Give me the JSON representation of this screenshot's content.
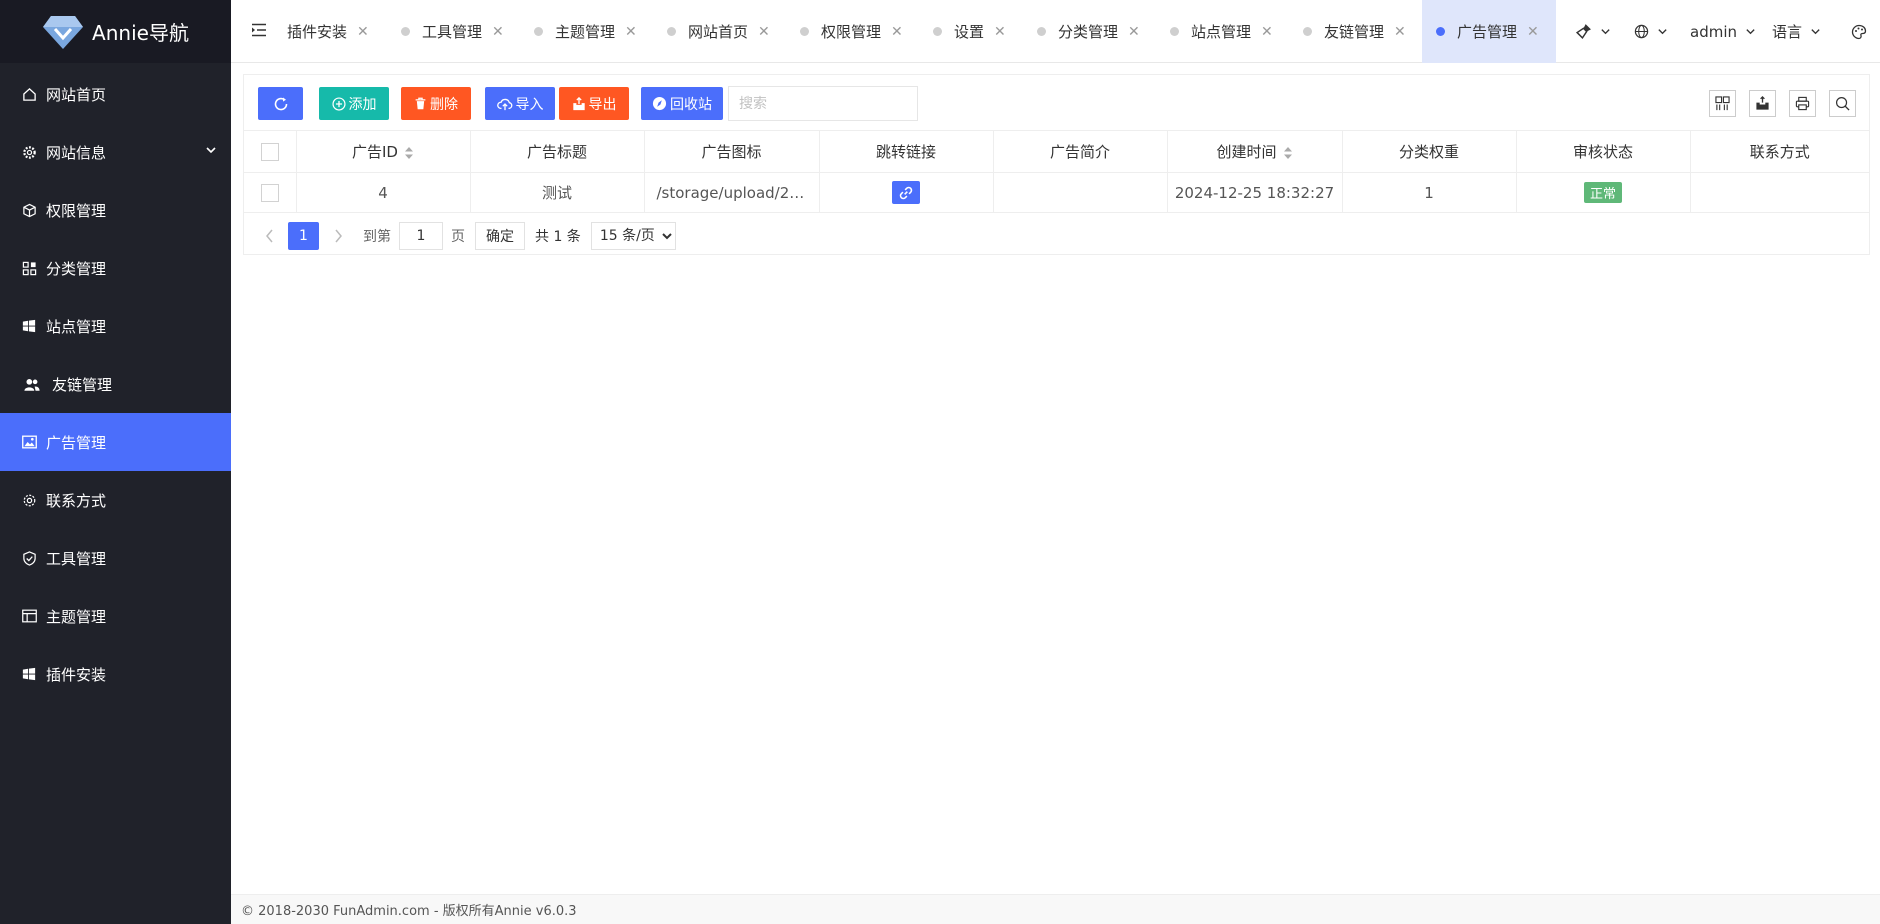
{
  "brand": {
    "name": "Annie导航"
  },
  "sidebar": {
    "items": [
      {
        "label": "网站首页",
        "icon": "home-icon"
      },
      {
        "label": "网站信息",
        "icon": "gear-icon"
      },
      {
        "label": "权限管理",
        "icon": "cube-icon"
      },
      {
        "label": "分类管理",
        "icon": "apps-icon"
      },
      {
        "label": "站点管理",
        "icon": "windows-icon"
      },
      {
        "label": "友链管理",
        "icon": "users-icon"
      },
      {
        "label": "广告管理",
        "icon": "image-icon"
      },
      {
        "label": "联系方式",
        "icon": "settings-icon"
      },
      {
        "label": "工具管理",
        "icon": "shield-icon"
      },
      {
        "label": "主题管理",
        "icon": "layout-icon"
      },
      {
        "label": "插件安装",
        "icon": "windows-icon"
      }
    ],
    "active": "广告管理"
  },
  "tabs": [
    {
      "label": "插件安装"
    },
    {
      "label": "工具管理"
    },
    {
      "label": "主题管理"
    },
    {
      "label": "网站首页"
    },
    {
      "label": "权限管理"
    },
    {
      "label": "设置"
    },
    {
      "label": "分类管理"
    },
    {
      "label": "站点管理"
    },
    {
      "label": "友链管理"
    },
    {
      "label": "广告管理"
    }
  ],
  "header_right": {
    "user": "admin",
    "language": "语言"
  },
  "toolbar": {
    "refresh": "",
    "add": "添加",
    "delete": "删除",
    "import": "导入",
    "export": "导出",
    "recycle": "回收站",
    "search_placeholder": "搜索"
  },
  "table": {
    "columns": [
      "广告ID",
      "广告标题",
      "广告图标",
      "跳转链接",
      "广告简介",
      "创建时间",
      "分类权重",
      "审核状态",
      "联系方式"
    ],
    "rows": [
      {
        "id": "4",
        "title": "测试",
        "icon_path": "/storage/upload/20...",
        "intro": "",
        "created": "2024-12-25 18:32:27",
        "weight": "1",
        "status": "正常",
        "contact": ""
      }
    ]
  },
  "pager": {
    "current": "1",
    "goto_label": "到第",
    "goto_value": "1",
    "page_suffix": "页",
    "confirm": "确定",
    "total": "共 1 条",
    "per_page": "15 条/页"
  },
  "footer": {
    "text": "© 2018-2030 FunAdmin.com - 版权所有Annie v6.0.3"
  },
  "colors": {
    "primary": "#4b6efb",
    "teal": "#16baaa",
    "orange": "#ff5722",
    "green": "#5fb878",
    "sidebar": "#20222a"
  }
}
